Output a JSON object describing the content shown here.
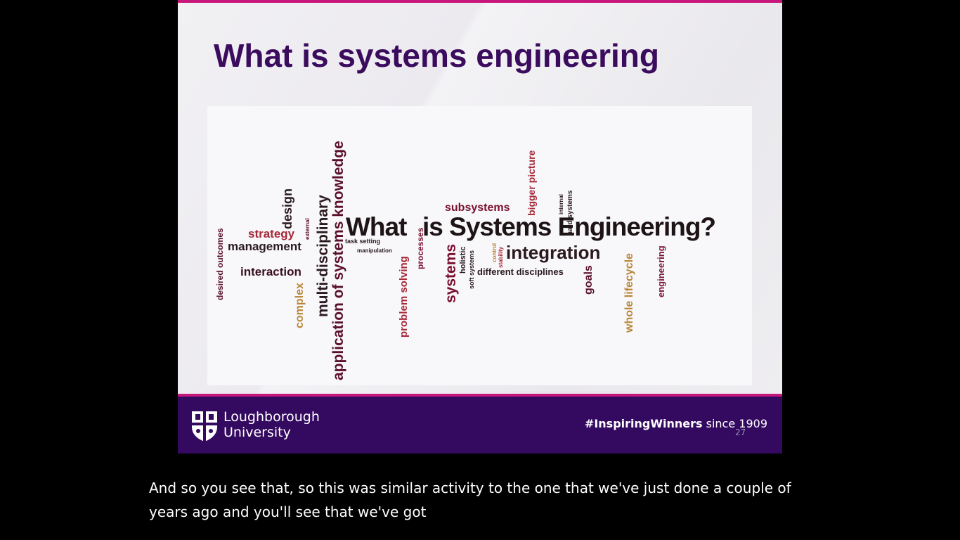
{
  "slide": {
    "title": "What is systems engineering",
    "word_cloud": {
      "headline_what": "What",
      "headline_rest": "is Systems Engineering?",
      "words": {
        "subsystems": "subsystems",
        "bigger_picture": "bigger picture",
        "internal": "internal",
        "hard_systems": "hard systems",
        "design": "design",
        "external": "external",
        "strategy": "strategy",
        "management": "management",
        "task_setting": "task setting",
        "manipulation": "manipulation",
        "interaction": "interaction",
        "desired_outcomes": "desired outcomes",
        "complex": "complex",
        "multi_disciplinary": "multi-disciplinary",
        "application": "application of systems knowledge",
        "problem_solving": "problem solving",
        "processes": "processes",
        "systems": "systems",
        "holistic": "holistic",
        "soft_systems": "soft systems",
        "control": "control",
        "stability": "stability",
        "integration": "integration",
        "different_disciplines": "different disciplines",
        "goals": "goals",
        "whole_lifecycle": "whole lifecycle",
        "engineering": "engineering"
      }
    },
    "footer": {
      "university_line1": "Loughborough",
      "university_line2": "University",
      "hashtag": "#InspiringWinners",
      "since": "since 1909",
      "page_number": "27"
    }
  },
  "caption": {
    "line1": "And so you see that, so this was similar activity to the one that we've just done a couple of",
    "line2": "years ago and you'll see that we've got"
  },
  "colors": {
    "title": "#3b0c5e",
    "accent_bar": "#c8177c",
    "footer_bg": "#340960",
    "word_dark": "#2a1a1e",
    "word_maroon": "#7a1030",
    "word_red": "#a52a3a",
    "word_tan": "#b8873a"
  }
}
